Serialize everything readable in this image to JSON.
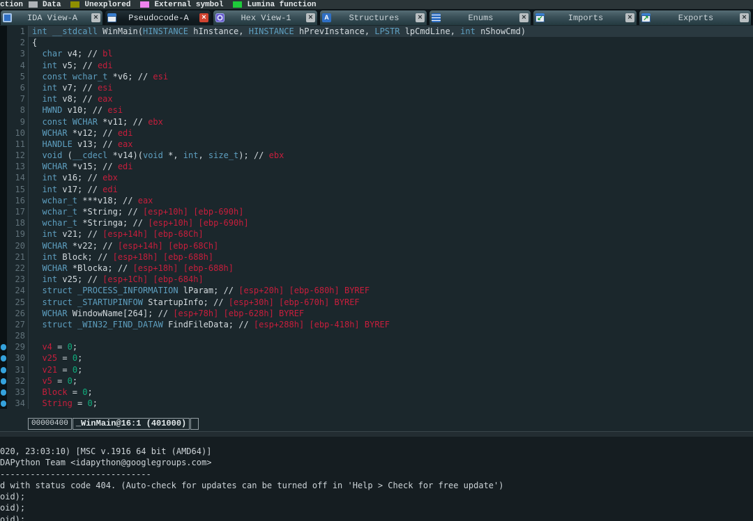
{
  "legend": {
    "fragment": "ction",
    "items": [
      {
        "label": "Data",
        "color": "#b0b4b8"
      },
      {
        "label": "Unexplored",
        "color": "#8f8f00"
      },
      {
        "label": "External symbol",
        "color": "#ee82ee"
      },
      {
        "label": "Lumina function",
        "color": "#1ecb3a"
      }
    ]
  },
  "tabs": [
    {
      "label": "IDA View-A",
      "icon": "graph-view-icon",
      "active": false
    },
    {
      "label": "Pseudocode-A",
      "icon": "pseudocode-icon",
      "active": true
    },
    {
      "label": "Hex View-1",
      "icon": "hex-view-icon",
      "active": false
    },
    {
      "label": "Structures",
      "icon": "structures-icon",
      "active": false,
      "glyph": "A"
    },
    {
      "label": "Enums",
      "icon": "enums-icon",
      "active": false
    },
    {
      "label": "Imports",
      "icon": "imports-icon",
      "active": false,
      "glyph": "↙"
    },
    {
      "label": "Exports",
      "icon": "exports-icon",
      "active": false,
      "glyph": "↗"
    }
  ],
  "close_glyph": "×",
  "pseudocode": {
    "lines": [
      {
        "n": 1,
        "hl": true,
        "mark": false,
        "t": [
          [
            "k",
            "int"
          ],
          [
            "i",
            " "
          ],
          [
            "k",
            "__stdcall"
          ],
          [
            "i",
            " WinMain("
          ],
          [
            "k",
            "HINSTANCE"
          ],
          [
            "i",
            " hInstance, "
          ],
          [
            "k",
            "HINSTANCE"
          ],
          [
            "i",
            " hPrevInstance, "
          ],
          [
            "k",
            "LPSTR"
          ],
          [
            "i",
            " lpCmdLine, "
          ],
          [
            "k",
            "int"
          ],
          [
            "i",
            " nShowCmd)"
          ]
        ]
      },
      {
        "n": 2,
        "hl": false,
        "mark": false,
        "t": [
          [
            "i",
            "{"
          ]
        ]
      },
      {
        "n": 3,
        "hl": false,
        "mark": false,
        "t": [
          [
            "i",
            "  "
          ],
          [
            "k",
            "char"
          ],
          [
            "i",
            " v4; // "
          ],
          [
            "r",
            "bl"
          ]
        ]
      },
      {
        "n": 4,
        "hl": false,
        "mark": false,
        "t": [
          [
            "i",
            "  "
          ],
          [
            "k",
            "int"
          ],
          [
            "i",
            " v5; // "
          ],
          [
            "r",
            "edi"
          ]
        ]
      },
      {
        "n": 5,
        "hl": false,
        "mark": false,
        "t": [
          [
            "i",
            "  "
          ],
          [
            "k",
            "const"
          ],
          [
            "i",
            " "
          ],
          [
            "k",
            "wchar_t"
          ],
          [
            "i",
            " *v6; // "
          ],
          [
            "r",
            "esi"
          ]
        ]
      },
      {
        "n": 6,
        "hl": false,
        "mark": false,
        "t": [
          [
            "i",
            "  "
          ],
          [
            "k",
            "int"
          ],
          [
            "i",
            " v7; // "
          ],
          [
            "r",
            "esi"
          ]
        ]
      },
      {
        "n": 7,
        "hl": false,
        "mark": false,
        "t": [
          [
            "i",
            "  "
          ],
          [
            "k",
            "int"
          ],
          [
            "i",
            " v8; // "
          ],
          [
            "r",
            "eax"
          ]
        ]
      },
      {
        "n": 8,
        "hl": false,
        "mark": false,
        "t": [
          [
            "i",
            "  "
          ],
          [
            "k",
            "HWND"
          ],
          [
            "i",
            " v10; // "
          ],
          [
            "r",
            "esi"
          ]
        ]
      },
      {
        "n": 9,
        "hl": false,
        "mark": false,
        "t": [
          [
            "i",
            "  "
          ],
          [
            "k",
            "const"
          ],
          [
            "i",
            " "
          ],
          [
            "k",
            "WCHAR"
          ],
          [
            "i",
            " *v11; // "
          ],
          [
            "r",
            "ebx"
          ]
        ]
      },
      {
        "n": 10,
        "hl": false,
        "mark": false,
        "t": [
          [
            "i",
            "  "
          ],
          [
            "k",
            "WCHAR"
          ],
          [
            "i",
            " *v12; // "
          ],
          [
            "r",
            "edi"
          ]
        ]
      },
      {
        "n": 11,
        "hl": false,
        "mark": false,
        "t": [
          [
            "i",
            "  "
          ],
          [
            "k",
            "HANDLE"
          ],
          [
            "i",
            " v13; // "
          ],
          [
            "r",
            "eax"
          ]
        ]
      },
      {
        "n": 12,
        "hl": false,
        "mark": false,
        "t": [
          [
            "i",
            "  "
          ],
          [
            "k",
            "void"
          ],
          [
            "i",
            " ("
          ],
          [
            "k",
            "__cdecl"
          ],
          [
            "i",
            " *v14)("
          ],
          [
            "k",
            "void"
          ],
          [
            "i",
            " *, "
          ],
          [
            "k",
            "int"
          ],
          [
            "i",
            ", "
          ],
          [
            "k",
            "size_t"
          ],
          [
            "i",
            "); // "
          ],
          [
            "r",
            "ebx"
          ]
        ]
      },
      {
        "n": 13,
        "hl": false,
        "mark": false,
        "t": [
          [
            "i",
            "  "
          ],
          [
            "k",
            "WCHAR"
          ],
          [
            "i",
            " *v15; // "
          ],
          [
            "r",
            "edi"
          ]
        ]
      },
      {
        "n": 14,
        "hl": false,
        "mark": false,
        "t": [
          [
            "i",
            "  "
          ],
          [
            "k",
            "int"
          ],
          [
            "i",
            " v16; // "
          ],
          [
            "r",
            "ebx"
          ]
        ]
      },
      {
        "n": 15,
        "hl": false,
        "mark": false,
        "t": [
          [
            "i",
            "  "
          ],
          [
            "k",
            "int"
          ],
          [
            "i",
            " v17; // "
          ],
          [
            "r",
            "edi"
          ]
        ]
      },
      {
        "n": 16,
        "hl": false,
        "mark": false,
        "t": [
          [
            "i",
            "  "
          ],
          [
            "k",
            "wchar_t"
          ],
          [
            "i",
            " ***v18; // "
          ],
          [
            "r",
            "eax"
          ]
        ]
      },
      {
        "n": 17,
        "hl": false,
        "mark": false,
        "t": [
          [
            "i",
            "  "
          ],
          [
            "k",
            "wchar_t"
          ],
          [
            "i",
            " *String; // "
          ],
          [
            "r",
            "[esp+10h] [ebp-690h]"
          ]
        ]
      },
      {
        "n": 18,
        "hl": false,
        "mark": false,
        "t": [
          [
            "i",
            "  "
          ],
          [
            "k",
            "wchar_t"
          ],
          [
            "i",
            " *Stringa; // "
          ],
          [
            "r",
            "[esp+10h] [ebp-690h]"
          ]
        ]
      },
      {
        "n": 19,
        "hl": false,
        "mark": false,
        "t": [
          [
            "i",
            "  "
          ],
          [
            "k",
            "int"
          ],
          [
            "i",
            " v21; // "
          ],
          [
            "r",
            "[esp+14h] [ebp-68Ch]"
          ]
        ]
      },
      {
        "n": 20,
        "hl": false,
        "mark": false,
        "t": [
          [
            "i",
            "  "
          ],
          [
            "k",
            "WCHAR"
          ],
          [
            "i",
            " *v22; // "
          ],
          [
            "r",
            "[esp+14h] [ebp-68Ch]"
          ]
        ]
      },
      {
        "n": 21,
        "hl": false,
        "mark": false,
        "t": [
          [
            "i",
            "  "
          ],
          [
            "k",
            "int"
          ],
          [
            "i",
            " Block; // "
          ],
          [
            "r",
            "[esp+18h] [ebp-688h]"
          ]
        ]
      },
      {
        "n": 22,
        "hl": false,
        "mark": false,
        "t": [
          [
            "i",
            "  "
          ],
          [
            "k",
            "WCHAR"
          ],
          [
            "i",
            " *Blocka; // "
          ],
          [
            "r",
            "[esp+18h] [ebp-688h]"
          ]
        ]
      },
      {
        "n": 23,
        "hl": false,
        "mark": false,
        "t": [
          [
            "i",
            "  "
          ],
          [
            "k",
            "int"
          ],
          [
            "i",
            " v25; // "
          ],
          [
            "r",
            "[esp+1Ch] [ebp-684h]"
          ]
        ]
      },
      {
        "n": 24,
        "hl": false,
        "mark": false,
        "t": [
          [
            "i",
            "  "
          ],
          [
            "k",
            "struct"
          ],
          [
            "i",
            " "
          ],
          [
            "k",
            "_PROCESS_INFORMATION"
          ],
          [
            "i",
            " lParam; // "
          ],
          [
            "r",
            "[esp+20h] [ebp-680h] BYREF"
          ]
        ]
      },
      {
        "n": 25,
        "hl": false,
        "mark": false,
        "t": [
          [
            "i",
            "  "
          ],
          [
            "k",
            "struct"
          ],
          [
            "i",
            " "
          ],
          [
            "k",
            "_STARTUPINFOW"
          ],
          [
            "i",
            " StartupInfo; // "
          ],
          [
            "r",
            "[esp+30h] [ebp-670h] BYREF"
          ]
        ]
      },
      {
        "n": 26,
        "hl": false,
        "mark": false,
        "t": [
          [
            "i",
            "  "
          ],
          [
            "k",
            "WCHAR"
          ],
          [
            "i",
            " WindowName[264]; // "
          ],
          [
            "r",
            "[esp+78h] [ebp-628h] BYREF"
          ]
        ]
      },
      {
        "n": 27,
        "hl": false,
        "mark": false,
        "t": [
          [
            "i",
            "  "
          ],
          [
            "k",
            "struct"
          ],
          [
            "i",
            " "
          ],
          [
            "k",
            "_WIN32_FIND_DATAW"
          ],
          [
            "i",
            " FindFileData; // "
          ],
          [
            "r",
            "[esp+288h] [ebp-418h] BYREF"
          ]
        ]
      },
      {
        "n": 28,
        "hl": false,
        "mark": false,
        "t": []
      },
      {
        "n": 29,
        "hl": false,
        "mark": true,
        "t": [
          [
            "i",
            "  "
          ],
          [
            "r",
            "v4"
          ],
          [
            "i",
            " = "
          ],
          [
            "g",
            "0"
          ],
          [
            "i",
            ";"
          ]
        ]
      },
      {
        "n": 30,
        "hl": false,
        "mark": true,
        "t": [
          [
            "i",
            "  "
          ],
          [
            "r",
            "v25"
          ],
          [
            "i",
            " = "
          ],
          [
            "g",
            "0"
          ],
          [
            "i",
            ";"
          ]
        ]
      },
      {
        "n": 31,
        "hl": false,
        "mark": true,
        "t": [
          [
            "i",
            "  "
          ],
          [
            "r",
            "v21"
          ],
          [
            "i",
            " = "
          ],
          [
            "g",
            "0"
          ],
          [
            "i",
            ";"
          ]
        ]
      },
      {
        "n": 32,
        "hl": false,
        "mark": true,
        "t": [
          [
            "i",
            "  "
          ],
          [
            "r",
            "v5"
          ],
          [
            "i",
            " = "
          ],
          [
            "g",
            "0"
          ],
          [
            "i",
            ";"
          ]
        ]
      },
      {
        "n": 33,
        "hl": false,
        "mark": true,
        "t": [
          [
            "i",
            "  "
          ],
          [
            "r",
            "Block"
          ],
          [
            "i",
            " = "
          ],
          [
            "g",
            "0"
          ],
          [
            "i",
            ";"
          ]
        ]
      },
      {
        "n": 34,
        "hl": false,
        "mark": true,
        "t": [
          [
            "i",
            "  "
          ],
          [
            "r",
            "String"
          ],
          [
            "i",
            " = "
          ],
          [
            "g",
            "0"
          ],
          [
            "i",
            ";"
          ]
        ]
      }
    ]
  },
  "status_bar": {
    "address": "00000400",
    "function_label": "_WinMain@16:1 (401000)"
  },
  "output": {
    "lines": [
      "020, 23:03:10) [MSC v.1916 64 bit (AMD64)]",
      "DAPython Team <idapython@googlegroups.com>",
      "------------------------------",
      "d with status code 404. (Auto-check for updates can be turned off in 'Help > Check for free update')",
      "oid);",
      "oid);",
      "oid);"
    ]
  },
  "colors": {
    "keyword": "#5e9fc0",
    "identifier": "#d4dbdf",
    "register_red": "#c81e3c",
    "number_green": "#0fae7d",
    "marker_blue": "#35a2dc",
    "code_bg": "#1b272c",
    "current_line_bg": "#2a3940",
    "close_red": "#d04330"
  }
}
